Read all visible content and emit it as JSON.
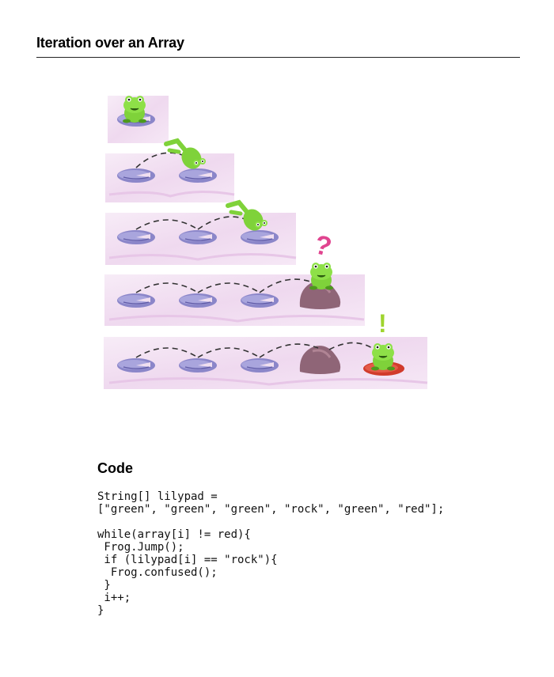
{
  "document": {
    "title": "Iteration over an Array"
  },
  "code_section": {
    "heading": "Code",
    "lines": [
      "String[] lilypad =",
      "[\"green\", \"green\", \"green\", \"rock\", \"green\", \"red\"];",
      "",
      "while(array[i] != red){",
      " Frog.Jump();",
      " if (lilypad[i] == \"rock\"){",
      "  Frog.confused();",
      " }",
      " i++;",
      "}"
    ]
  },
  "illustration": {
    "confused_symbol": "?",
    "success_symbol": "!",
    "colors": {
      "lilypad": "#8b86c9",
      "lilypad_dark": "#5f5aa6",
      "rock": "#8f6577",
      "red_pad": "#d13b2c",
      "frog": "#7fd23a",
      "frog_dark": "#4d9a1c",
      "question_mark": "#e0448f",
      "exclamation_mark": "#9fd42e",
      "water_bg": "#f3e3f3"
    }
  }
}
